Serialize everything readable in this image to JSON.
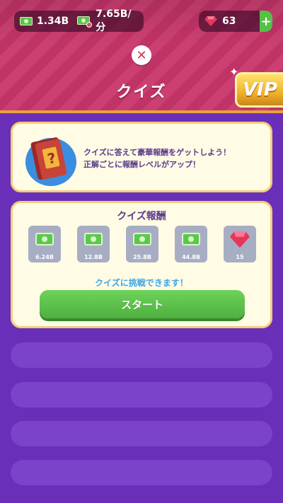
{
  "currency": {
    "cash": "1.34B",
    "rate": "7.65B/分",
    "gems": "63",
    "add_label": "+"
  },
  "header": {
    "close_label": "✕",
    "title": "クイズ",
    "vip_label": "VIP"
  },
  "info": {
    "line1": "クイズに答えて豪華報酬をゲットしよう！",
    "line2": "正解ごとに報酬レベルがアップ！"
  },
  "rewards": {
    "title": "クイズ報酬",
    "items": [
      {
        "type": "cash",
        "amount": "6.24B"
      },
      {
        "type": "cash",
        "amount": "12.8B"
      },
      {
        "type": "cash",
        "amount": "25.8B"
      },
      {
        "type": "cash",
        "amount": "44.8B"
      },
      {
        "type": "gem",
        "amount": "15"
      }
    ],
    "hint": "クイズに挑戦できます！",
    "start_label": "スタート"
  },
  "colors": {
    "header": "#c8356a",
    "background": "#6a2fb8",
    "card": "#fffbe5",
    "button": "#55c148"
  }
}
